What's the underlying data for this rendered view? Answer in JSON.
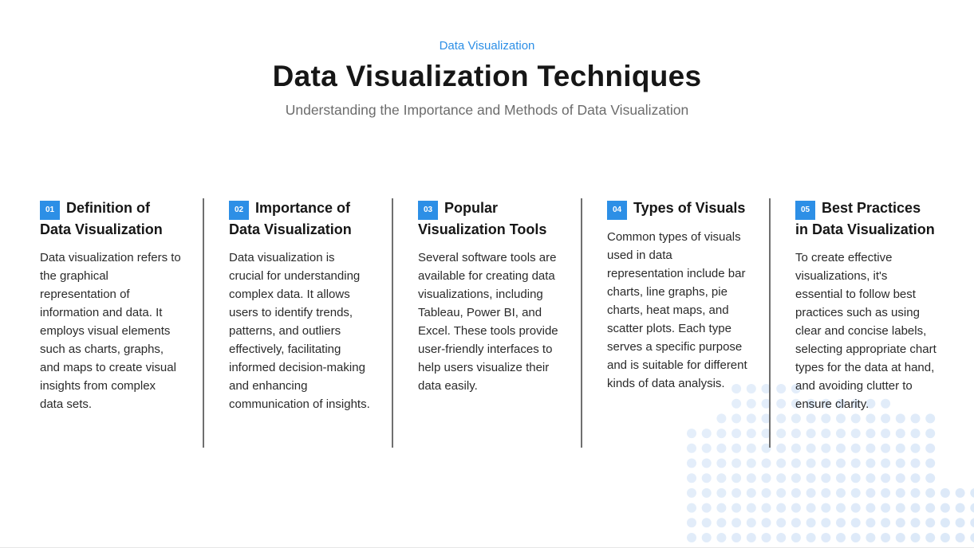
{
  "header": {
    "kicker": "Data Visualization",
    "title": "Data Visualization Techniques",
    "subtitle": "Understanding the Importance and Methods of Data Visualization"
  },
  "colors": {
    "accent": "#2d8fe6",
    "title": "#161616",
    "subtitle": "#6c6c6c",
    "dots": "#dbe8f8"
  },
  "columns": [
    {
      "number": "01",
      "title": "Definition of Data Visualization",
      "body": "Data visualization refers to the graphical representation of information and data. It employs visual elements such as charts, graphs, and maps to create visual insights from complex data sets."
    },
    {
      "number": "02",
      "title": "Importance of Data Visualization",
      "body": "Data visualization is crucial for understanding complex data. It allows users to identify trends, patterns, and outliers effectively, facilitating informed decision-making and enhancing communication of insights."
    },
    {
      "number": "03",
      "title": "Popular Visualization Tools",
      "body": "Several software tools are available for creating data visualizations, including Tableau, Power BI, and Excel. These tools provide user-friendly interfaces to help users visualize their data easily."
    },
    {
      "number": "04",
      "title": "Types of Visuals",
      "body": "Common types of visuals used in data representation include bar charts, line graphs, pie charts, heat maps, and scatter plots. Each type serves a specific purpose and is suitable for different kinds of data analysis."
    },
    {
      "number": "05",
      "title": "Best Practices in Data Visualization",
      "body": "To create effective visualizations, it's essential to follow best practices such as using clear and concise labels, selecting appropriate chart types for the data at hand, and avoiding clutter to ensure clarity."
    }
  ]
}
